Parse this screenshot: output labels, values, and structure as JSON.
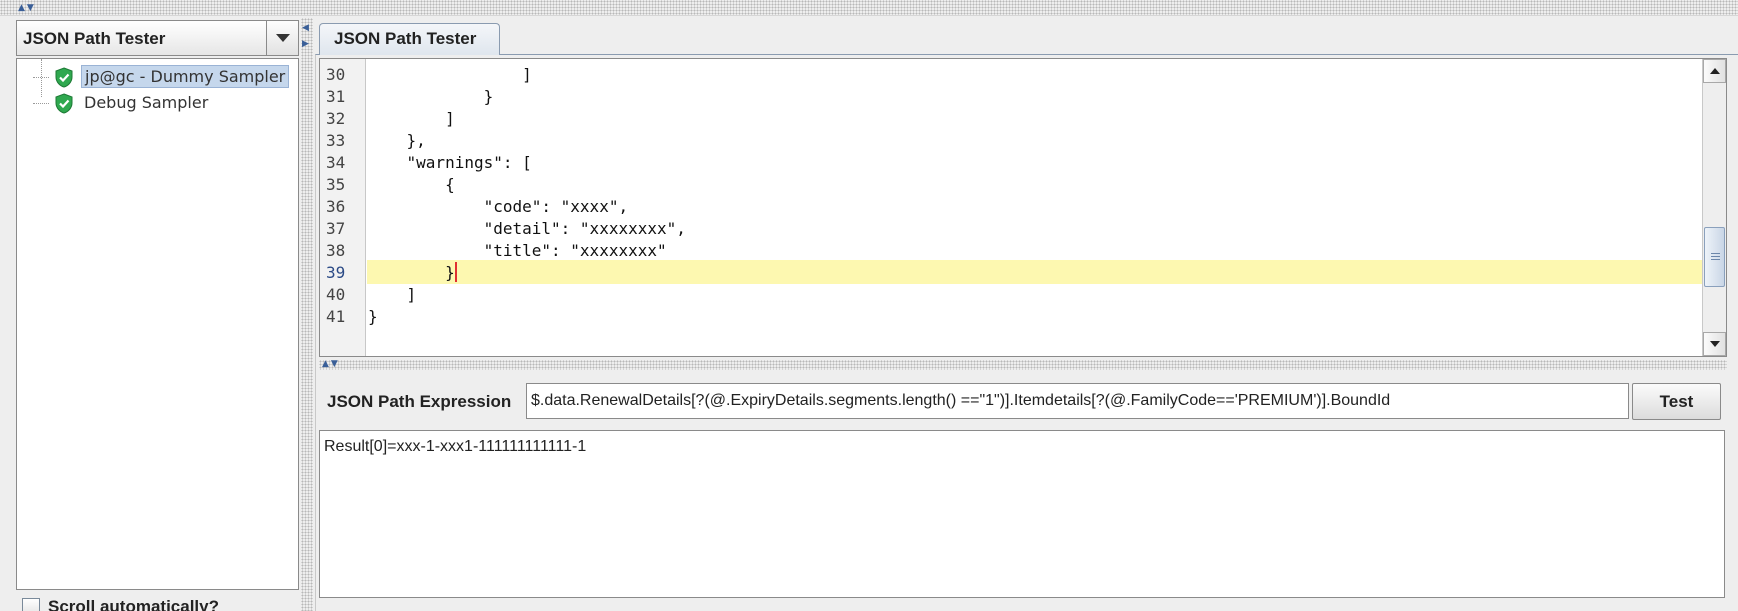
{
  "left_panel": {
    "combo_value": "JSON Path Tester",
    "tree_items": [
      {
        "label": "jp@gc - Dummy Sampler",
        "status": "success",
        "selected": true
      },
      {
        "label": "Debug Sampler",
        "status": "success",
        "selected": false
      }
    ],
    "scroll_checkbox_label": "Scroll automatically?",
    "scroll_checked": false
  },
  "tab": {
    "label": "JSON Path Tester"
  },
  "editor": {
    "current_line": "39",
    "lines": [
      {
        "num": "30",
        "text": "                ]"
      },
      {
        "num": "31",
        "text": "            }"
      },
      {
        "num": "32",
        "text": "        ]"
      },
      {
        "num": "33",
        "text": "    },"
      },
      {
        "num": "34",
        "text": "    \"warnings\": ["
      },
      {
        "num": "35",
        "text": "        {"
      },
      {
        "num": "36",
        "text": "            \"code\": \"xxxx\","
      },
      {
        "num": "37",
        "text": "            \"detail\": \"xxxxxxxx\","
      },
      {
        "num": "38",
        "text": "            \"title\": \"xxxxxxxx\""
      },
      {
        "num": "39",
        "text": "        }"
      },
      {
        "num": "40",
        "text": "    ]"
      },
      {
        "num": "41",
        "text": "}"
      }
    ]
  },
  "expression": {
    "label": "JSON Path Expression",
    "value": "$.data.RenewalDetails[?(@.ExpiryDetails.segments.length() ==\"1\")].Itemdetails[?(@.FamilyCode=='PREMIUM')].BoundId",
    "button_label": "Test"
  },
  "result": {
    "text": "Result[0]=xxx-1-xxx1-111111111111-1"
  },
  "colors": {
    "selection": "#c5d7ec",
    "current_line_highlight": "#fdf8b0",
    "success_icon": "#2fa84f",
    "caret": "#e03030"
  }
}
